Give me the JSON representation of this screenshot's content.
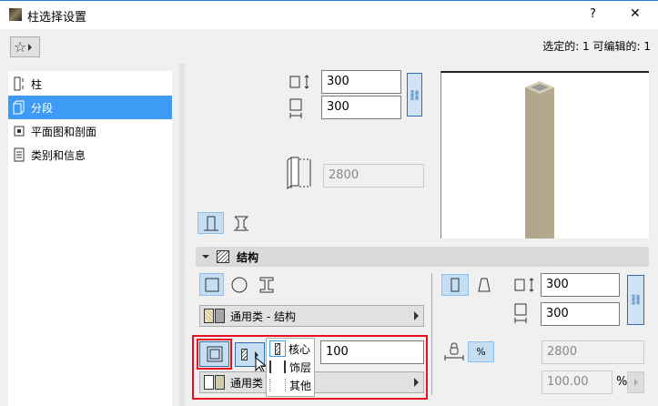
{
  "title": "柱选择设置",
  "title_buttons": {
    "help": "?",
    "close": "✕"
  },
  "status": "选定的: 1 可编辑的: 1",
  "sidebar": {
    "items": [
      {
        "label": "柱",
        "icon": "column-icon"
      },
      {
        "label": "分段",
        "icon": "segment-icon",
        "selected": true
      },
      {
        "label": "平面图和剖面",
        "icon": "floor-plan-section-icon"
      },
      {
        "label": "类别和信息",
        "icon": "classification-info-icon"
      }
    ]
  },
  "top": {
    "width": "300",
    "depth": "300",
    "height": "2800"
  },
  "section": {
    "title": "结构"
  },
  "structure": {
    "building_material": "通用类 - 结构",
    "core_value": "100",
    "veneer_material": "通用类 - ",
    "width": "300",
    "depth": "300",
    "height": "2800",
    "percent": "100.00",
    "percent_unit": "%",
    "percent_toggle": "%"
  },
  "popup_menu": {
    "items": [
      "核心",
      "饰层",
      "其他"
    ]
  },
  "colors": {
    "accent": "#3d9bf5",
    "highlight": "#e81123",
    "column": "#b1a58c"
  }
}
